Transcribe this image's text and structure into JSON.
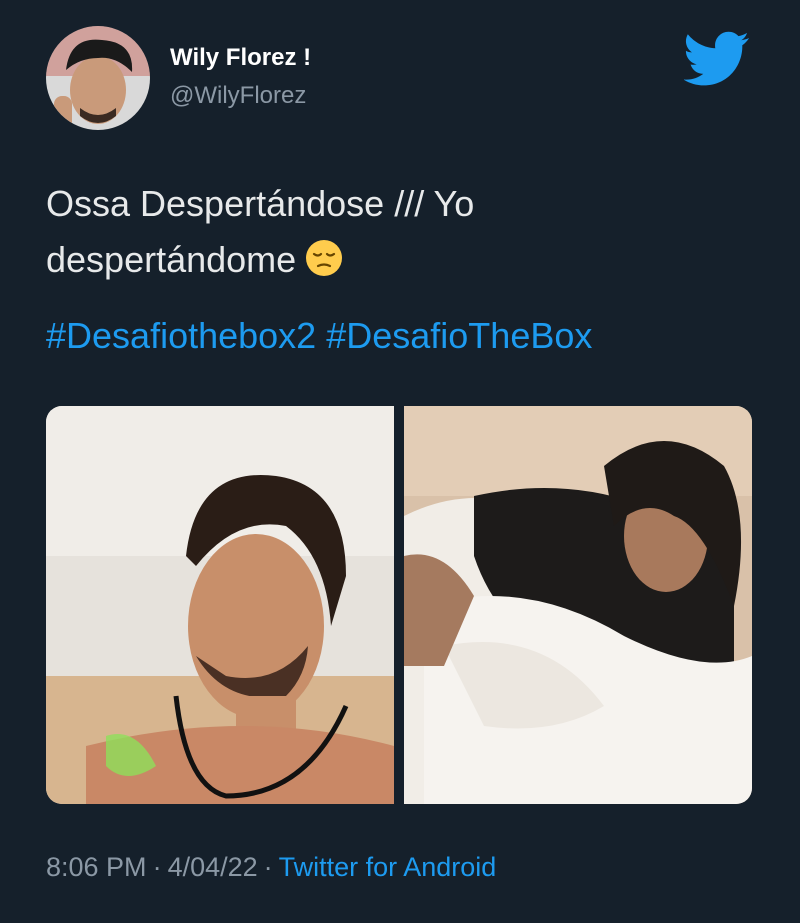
{
  "author": {
    "display_name": "Wily Florez !",
    "handle": "@WilyFlorez",
    "avatar_icon": "profile-photo"
  },
  "brand": {
    "icon": "twitter-bird-icon",
    "color": "#1d9bf0"
  },
  "tweet": {
    "line1": "Ossa Despertándose /// Yo",
    "line2": "despertándome",
    "emoji": "pensive-face",
    "hashtags": [
      "#Desafiothebox2",
      "#DesafioTheBox"
    ]
  },
  "media": {
    "photos": [
      {
        "description_icon": "photo-smiling-man"
      },
      {
        "description_icon": "photo-man-in-bed"
      }
    ]
  },
  "meta": {
    "time": "8:06 PM",
    "date": "4/04/22",
    "dot": "·",
    "source": "Twitter for Android"
  },
  "colors": {
    "background": "#15202b",
    "text": "#e7e9ea",
    "secondary": "#8b98a5",
    "link": "#1d9bf0"
  }
}
